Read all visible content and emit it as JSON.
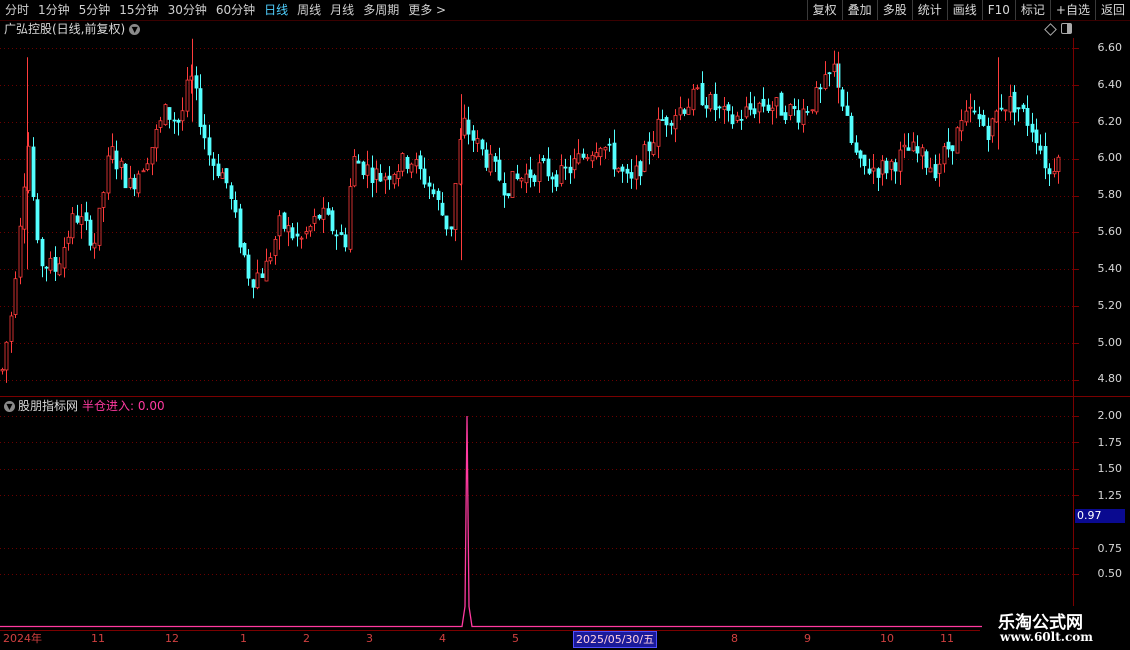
{
  "toolbar": {
    "periods": [
      "分时",
      "1分钟",
      "5分钟",
      "15分钟",
      "30分钟",
      "60分钟",
      "日线",
      "周线",
      "月线",
      "多周期",
      "更多 >"
    ],
    "active_period": "日线",
    "right_buttons": [
      "复权",
      "叠加",
      "多股",
      "统计",
      "画线",
      "F10",
      "标记",
      "+自选",
      "返回"
    ]
  },
  "main_chart": {
    "title": "广弘控股(日线,前复权)",
    "y_ticks": [
      "6.60",
      "6.40",
      "6.20",
      "6.00",
      "5.80",
      "5.60",
      "5.40",
      "5.20",
      "5.00",
      "4.80"
    ]
  },
  "indicator": {
    "name": "股朋指标网",
    "value_label": "半仓进入: 0.00",
    "y_ticks": [
      "2.00",
      "1.75",
      "1.50",
      "1.25",
      "0.75",
      "0.50"
    ],
    "current_value": "0.97"
  },
  "date_axis": {
    "labels": [
      "2024年",
      "11",
      "12",
      "1",
      "2",
      "3",
      "4",
      "5",
      "2025/05/30/五",
      "8",
      "9",
      "10",
      "11"
    ]
  },
  "watermark": {
    "line1": "乐淘公式网",
    "line2": "www.60lt.com"
  },
  "colors": {
    "up": "#ff3c3c",
    "down": "#54ffff",
    "indicator": "#ff3aa0",
    "frame": "#7a0000"
  }
}
